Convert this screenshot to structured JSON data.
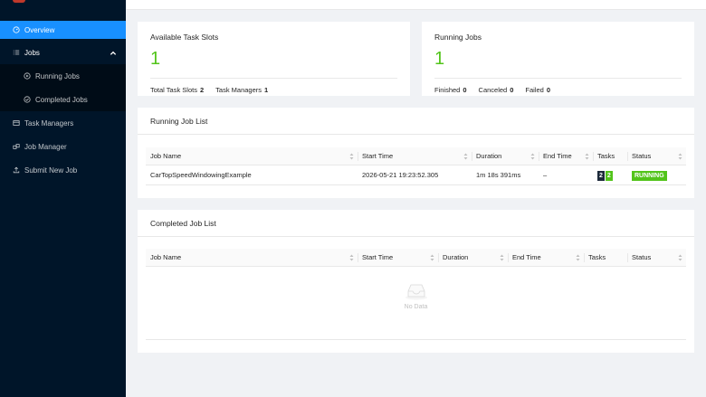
{
  "sidebar": {
    "items": [
      {
        "label": "Overview",
        "icon": "dashboard-icon"
      },
      {
        "label": "Jobs",
        "icon": "list-icon"
      },
      {
        "label": "Running Jobs",
        "icon": "play-circle-icon"
      },
      {
        "label": "Completed Jobs",
        "icon": "check-circle-icon"
      },
      {
        "label": "Task Managers",
        "icon": "task-manager-icon"
      },
      {
        "label": "Job Manager",
        "icon": "cluster-icon"
      },
      {
        "label": "Submit New Job",
        "icon": "upload-icon"
      }
    ]
  },
  "stats": {
    "slots": {
      "title": "Available Task Slots",
      "value": "1",
      "total_label": "Total Task Slots",
      "total_value": "2",
      "tm_label": "Task Managers",
      "tm_value": "1"
    },
    "jobs": {
      "title": "Running Jobs",
      "value": "1",
      "finished_label": "Finished",
      "finished_value": "0",
      "canceled_label": "Canceled",
      "canceled_value": "0",
      "failed_label": "Failed",
      "failed_value": "0"
    }
  },
  "running": {
    "title": "Running Job List",
    "columns": [
      "Job Name",
      "Start Time",
      "Duration",
      "End Time",
      "Tasks",
      "Status"
    ],
    "rows": [
      {
        "name": "CarTopSpeedWindowingExample",
        "start": "2026-05-21 19:23:52.305",
        "duration": "1m 18s 391ms",
        "end": "–",
        "tasks_a": "2",
        "tasks_b": "2",
        "status": "RUNNING"
      }
    ]
  },
  "completed": {
    "title": "Completed Job List",
    "columns": [
      "Job Name",
      "Start Time",
      "Duration",
      "End Time",
      "Tasks",
      "Status"
    ],
    "empty_text": "No Data"
  },
  "colors": {
    "sidebar_bg": "#001529",
    "accent": "#1890ff",
    "success": "#52c41a"
  }
}
